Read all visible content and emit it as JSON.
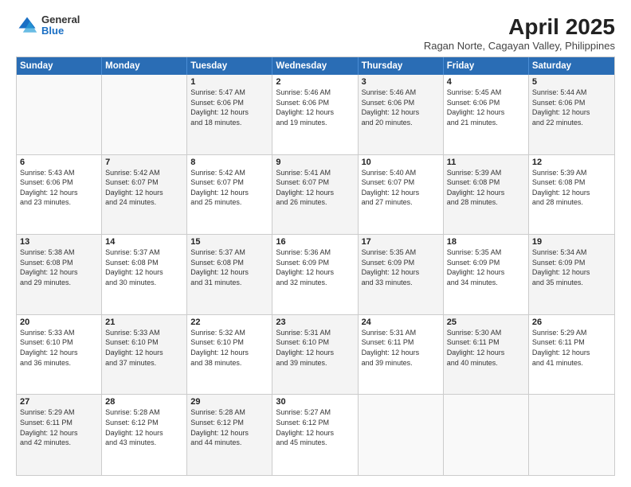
{
  "header": {
    "logo_general": "General",
    "logo_blue": "Blue",
    "month_year": "April 2025",
    "location": "Ragan Norte, Cagayan Valley, Philippines"
  },
  "calendar": {
    "days": [
      "Sunday",
      "Monday",
      "Tuesday",
      "Wednesday",
      "Thursday",
      "Friday",
      "Saturday"
    ],
    "weeks": [
      [
        {
          "day": "",
          "lines": [],
          "empty": true
        },
        {
          "day": "",
          "lines": [],
          "empty": true
        },
        {
          "day": "1",
          "lines": [
            "Sunrise: 5:47 AM",
            "Sunset: 6:06 PM",
            "Daylight: 12 hours",
            "and 18 minutes."
          ]
        },
        {
          "day": "2",
          "lines": [
            "Sunrise: 5:46 AM",
            "Sunset: 6:06 PM",
            "Daylight: 12 hours",
            "and 19 minutes."
          ]
        },
        {
          "day": "3",
          "lines": [
            "Sunrise: 5:46 AM",
            "Sunset: 6:06 PM",
            "Daylight: 12 hours",
            "and 20 minutes."
          ]
        },
        {
          "day": "4",
          "lines": [
            "Sunrise: 5:45 AM",
            "Sunset: 6:06 PM",
            "Daylight: 12 hours",
            "and 21 minutes."
          ]
        },
        {
          "day": "5",
          "lines": [
            "Sunrise: 5:44 AM",
            "Sunset: 6:06 PM",
            "Daylight: 12 hours",
            "and 22 minutes."
          ]
        }
      ],
      [
        {
          "day": "6",
          "lines": [
            "Sunrise: 5:43 AM",
            "Sunset: 6:06 PM",
            "Daylight: 12 hours",
            "and 23 minutes."
          ]
        },
        {
          "day": "7",
          "lines": [
            "Sunrise: 5:42 AM",
            "Sunset: 6:07 PM",
            "Daylight: 12 hours",
            "and 24 minutes."
          ]
        },
        {
          "day": "8",
          "lines": [
            "Sunrise: 5:42 AM",
            "Sunset: 6:07 PM",
            "Daylight: 12 hours",
            "and 25 minutes."
          ]
        },
        {
          "day": "9",
          "lines": [
            "Sunrise: 5:41 AM",
            "Sunset: 6:07 PM",
            "Daylight: 12 hours",
            "and 26 minutes."
          ]
        },
        {
          "day": "10",
          "lines": [
            "Sunrise: 5:40 AM",
            "Sunset: 6:07 PM",
            "Daylight: 12 hours",
            "and 27 minutes."
          ]
        },
        {
          "day": "11",
          "lines": [
            "Sunrise: 5:39 AM",
            "Sunset: 6:08 PM",
            "Daylight: 12 hours",
            "and 28 minutes."
          ]
        },
        {
          "day": "12",
          "lines": [
            "Sunrise: 5:39 AM",
            "Sunset: 6:08 PM",
            "Daylight: 12 hours",
            "and 28 minutes."
          ]
        }
      ],
      [
        {
          "day": "13",
          "lines": [
            "Sunrise: 5:38 AM",
            "Sunset: 6:08 PM",
            "Daylight: 12 hours",
            "and 29 minutes."
          ]
        },
        {
          "day": "14",
          "lines": [
            "Sunrise: 5:37 AM",
            "Sunset: 6:08 PM",
            "Daylight: 12 hours",
            "and 30 minutes."
          ]
        },
        {
          "day": "15",
          "lines": [
            "Sunrise: 5:37 AM",
            "Sunset: 6:08 PM",
            "Daylight: 12 hours",
            "and 31 minutes."
          ]
        },
        {
          "day": "16",
          "lines": [
            "Sunrise: 5:36 AM",
            "Sunset: 6:09 PM",
            "Daylight: 12 hours",
            "and 32 minutes."
          ]
        },
        {
          "day": "17",
          "lines": [
            "Sunrise: 5:35 AM",
            "Sunset: 6:09 PM",
            "Daylight: 12 hours",
            "and 33 minutes."
          ]
        },
        {
          "day": "18",
          "lines": [
            "Sunrise: 5:35 AM",
            "Sunset: 6:09 PM",
            "Daylight: 12 hours",
            "and 34 minutes."
          ]
        },
        {
          "day": "19",
          "lines": [
            "Sunrise: 5:34 AM",
            "Sunset: 6:09 PM",
            "Daylight: 12 hours",
            "and 35 minutes."
          ]
        }
      ],
      [
        {
          "day": "20",
          "lines": [
            "Sunrise: 5:33 AM",
            "Sunset: 6:10 PM",
            "Daylight: 12 hours",
            "and 36 minutes."
          ]
        },
        {
          "day": "21",
          "lines": [
            "Sunrise: 5:33 AM",
            "Sunset: 6:10 PM",
            "Daylight: 12 hours",
            "and 37 minutes."
          ]
        },
        {
          "day": "22",
          "lines": [
            "Sunrise: 5:32 AM",
            "Sunset: 6:10 PM",
            "Daylight: 12 hours",
            "and 38 minutes."
          ]
        },
        {
          "day": "23",
          "lines": [
            "Sunrise: 5:31 AM",
            "Sunset: 6:10 PM",
            "Daylight: 12 hours",
            "and 39 minutes."
          ]
        },
        {
          "day": "24",
          "lines": [
            "Sunrise: 5:31 AM",
            "Sunset: 6:11 PM",
            "Daylight: 12 hours",
            "and 39 minutes."
          ]
        },
        {
          "day": "25",
          "lines": [
            "Sunrise: 5:30 AM",
            "Sunset: 6:11 PM",
            "Daylight: 12 hours",
            "and 40 minutes."
          ]
        },
        {
          "day": "26",
          "lines": [
            "Sunrise: 5:29 AM",
            "Sunset: 6:11 PM",
            "Daylight: 12 hours",
            "and 41 minutes."
          ]
        }
      ],
      [
        {
          "day": "27",
          "lines": [
            "Sunrise: 5:29 AM",
            "Sunset: 6:11 PM",
            "Daylight: 12 hours",
            "and 42 minutes."
          ]
        },
        {
          "day": "28",
          "lines": [
            "Sunrise: 5:28 AM",
            "Sunset: 6:12 PM",
            "Daylight: 12 hours",
            "and 43 minutes."
          ]
        },
        {
          "day": "29",
          "lines": [
            "Sunrise: 5:28 AM",
            "Sunset: 6:12 PM",
            "Daylight: 12 hours",
            "and 44 minutes."
          ]
        },
        {
          "day": "30",
          "lines": [
            "Sunrise: 5:27 AM",
            "Sunset: 6:12 PM",
            "Daylight: 12 hours",
            "and 45 minutes."
          ]
        },
        {
          "day": "",
          "lines": [],
          "empty": true
        },
        {
          "day": "",
          "lines": [],
          "empty": true
        },
        {
          "day": "",
          "lines": [],
          "empty": true
        }
      ]
    ]
  }
}
